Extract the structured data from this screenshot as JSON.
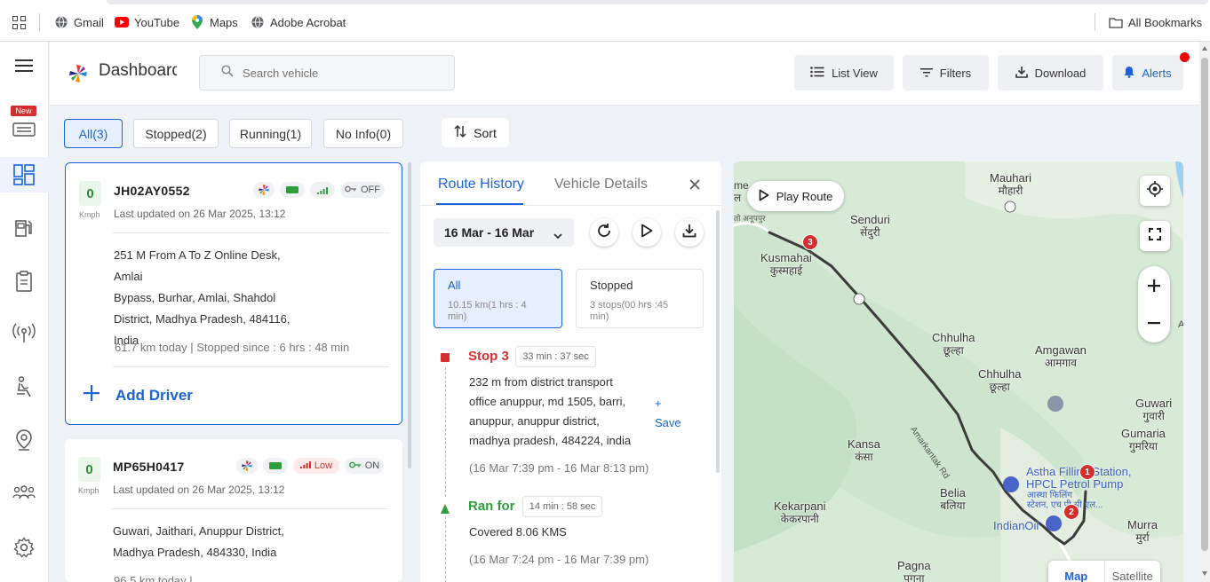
{
  "bookmarks": {
    "items": [
      {
        "label": "Gmail",
        "icon": "globe-icon"
      },
      {
        "label": "YouTube",
        "icon": "youtube-icon"
      },
      {
        "label": "Maps",
        "icon": "maps-pin-icon"
      },
      {
        "label": "Adobe Acrobat",
        "icon": "globe-icon"
      }
    ],
    "all_bookmarks": "All Bookmarks"
  },
  "rail": {
    "new_badge": "New",
    "items": [
      "vehicle-list-icon",
      "dashboard-icon",
      "fuel-icon",
      "clipboard-icon",
      "signal-tower-icon",
      "driver-seat-icon",
      "location-pin-icon",
      "team-icon",
      "settings-icon"
    ]
  },
  "header": {
    "title": "Dashboard",
    "search_placeholder": "Search vehicle",
    "buttons": {
      "list_view": "List View",
      "filters": "Filters",
      "download": "Download",
      "alerts": "Alerts"
    }
  },
  "filters": {
    "chips": [
      {
        "label": "All(3)",
        "active": true
      },
      {
        "label": "Stopped(2)",
        "active": false
      },
      {
        "label": "Running(1)",
        "active": false
      },
      {
        "label": "No Info(0)",
        "active": false
      }
    ],
    "sort": "Sort"
  },
  "vehicles": [
    {
      "speed": "0",
      "unit": "Kmph",
      "plate": "JH02AY0552",
      "updated": "Last updated on 26 Mar 2025, 13:12",
      "battery_level": "",
      "ignition": "OFF",
      "address": [
        "251 M From A To Z Online Desk, Amlai",
        "Bypass, Burhar, Amlai, Shahdol",
        "District, Madhya Pradesh, 484116,",
        "India"
      ],
      "stats": "61.7 km today | Stopped since : 6 hrs : 48 min",
      "add_driver": "Add Driver"
    },
    {
      "speed": "0",
      "unit": "Kmph",
      "plate": "MP65H0417",
      "updated": "Last updated on 26 Mar 2025, 13:12",
      "signal_level": "Low",
      "ignition": "ON",
      "address": [
        "Guwari, Jaithari, Anuppur District,",
        "Madhya Pradesh, 484330, India"
      ],
      "stats": "96.5 km today |"
    }
  ],
  "route_panel": {
    "tabs": [
      "Route History",
      "Vehicle Details"
    ],
    "date_range": "16 Mar - 16 Mar",
    "summary": {
      "all": {
        "title": "All",
        "sub": "10.15 km(1 hrs : 4 min)"
      },
      "stopped": {
        "title": "Stopped",
        "sub": "3 stops(00 hrs :45 min)"
      }
    },
    "timeline": [
      {
        "title": "Stop 3",
        "duration": "33 min : 37 sec",
        "lines": [
          "232 m from district transport",
          "office anuppur, md 1505, barri,",
          "anuppur, anuppur district,",
          "madhya pradesh, 484224, india"
        ],
        "save_plus": "+",
        "save": "Save",
        "time": "(16 Mar 7:39 pm - 16 Mar 8:13 pm)"
      },
      {
        "title": "Ran for",
        "duration": "14 min : 58 sec",
        "lines": [
          "Covered 8.06 KMS"
        ],
        "time": "(16 Mar 7:24 pm - 16 Mar 7:39 pm)"
      }
    ]
  },
  "map": {
    "play_route": "Play Route",
    "map_type": [
      "Map",
      "Satellite"
    ],
    "places": [
      {
        "en": "Mauhari",
        "hi": "मौहारी"
      },
      {
        "en": "Senduri",
        "hi": "सेंदुरी"
      },
      {
        "en": "Kusmahai",
        "hi": "कुस्महाई"
      },
      {
        "en": "Chhulha",
        "hi": "छूल्हा"
      },
      {
        "en": "Chhulha",
        "hi": "छूल्हा"
      },
      {
        "en": "Amgawan",
        "hi": "आमगाव"
      },
      {
        "en": "Guwari",
        "hi": "गुवारी"
      },
      {
        "en": "Gumaria",
        "hi": "गुमरिया"
      },
      {
        "en": "Kansa",
        "hi": "कंसा"
      },
      {
        "en": "Belia",
        "hi": "बलिया"
      },
      {
        "en": "Kekarpani",
        "hi": "केकरपानी"
      },
      {
        "en": "Murra",
        "hi": "मुर्रा"
      },
      {
        "en": "Pagna",
        "hi": "पगना"
      }
    ],
    "poi": {
      "astha_line1": "Astha Filling Station,",
      "astha_line2": "HPCL Petrol Pump",
      "astha_hi1": "आस्था फिलिंग",
      "astha_hi2": "स्टेशन, एच पी सी एल...",
      "indianoil": "IndianOil"
    },
    "edge_text": [
      "me",
      "ल",
      "तो अनूपपुर",
      "A"
    ],
    "road": "Amarkantak Rd",
    "markers": [
      "3",
      "1",
      "2"
    ],
    "colors": {
      "route": "#3b3b3b",
      "marker": "#d32f2f",
      "accent": "#1a63d8"
    }
  }
}
